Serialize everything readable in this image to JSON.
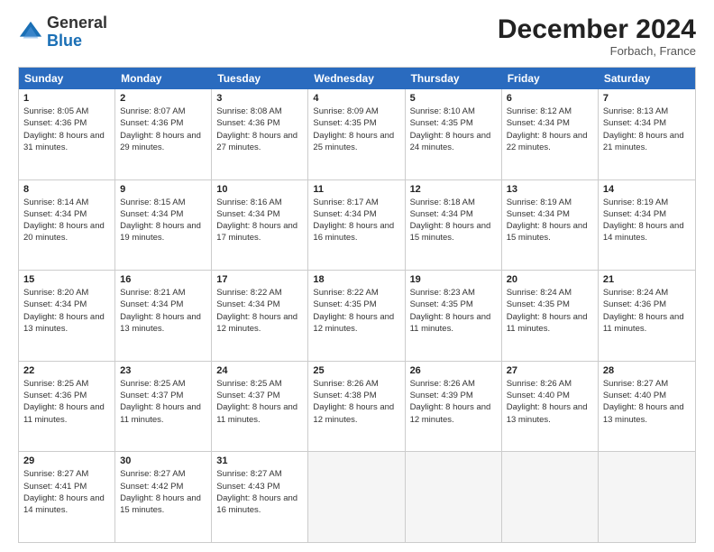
{
  "header": {
    "logo_line1": "General",
    "logo_line2": "Blue",
    "month": "December 2024",
    "location": "Forbach, France"
  },
  "weekdays": [
    "Sunday",
    "Monday",
    "Tuesday",
    "Wednesday",
    "Thursday",
    "Friday",
    "Saturday"
  ],
  "rows": [
    [
      {
        "day": "1",
        "sunrise": "8:05 AM",
        "sunset": "4:36 PM",
        "daylight": "8 hours and 31 minutes."
      },
      {
        "day": "2",
        "sunrise": "8:07 AM",
        "sunset": "4:36 PM",
        "daylight": "8 hours and 29 minutes."
      },
      {
        "day": "3",
        "sunrise": "8:08 AM",
        "sunset": "4:36 PM",
        "daylight": "8 hours and 27 minutes."
      },
      {
        "day": "4",
        "sunrise": "8:09 AM",
        "sunset": "4:35 PM",
        "daylight": "8 hours and 25 minutes."
      },
      {
        "day": "5",
        "sunrise": "8:10 AM",
        "sunset": "4:35 PM",
        "daylight": "8 hours and 24 minutes."
      },
      {
        "day": "6",
        "sunrise": "8:12 AM",
        "sunset": "4:34 PM",
        "daylight": "8 hours and 22 minutes."
      },
      {
        "day": "7",
        "sunrise": "8:13 AM",
        "sunset": "4:34 PM",
        "daylight": "8 hours and 21 minutes."
      }
    ],
    [
      {
        "day": "8",
        "sunrise": "8:14 AM",
        "sunset": "4:34 PM",
        "daylight": "8 hours and 20 minutes."
      },
      {
        "day": "9",
        "sunrise": "8:15 AM",
        "sunset": "4:34 PM",
        "daylight": "8 hours and 19 minutes."
      },
      {
        "day": "10",
        "sunrise": "8:16 AM",
        "sunset": "4:34 PM",
        "daylight": "8 hours and 17 minutes."
      },
      {
        "day": "11",
        "sunrise": "8:17 AM",
        "sunset": "4:34 PM",
        "daylight": "8 hours and 16 minutes."
      },
      {
        "day": "12",
        "sunrise": "8:18 AM",
        "sunset": "4:34 PM",
        "daylight": "8 hours and 15 minutes."
      },
      {
        "day": "13",
        "sunrise": "8:19 AM",
        "sunset": "4:34 PM",
        "daylight": "8 hours and 15 minutes."
      },
      {
        "day": "14",
        "sunrise": "8:19 AM",
        "sunset": "4:34 PM",
        "daylight": "8 hours and 14 minutes."
      }
    ],
    [
      {
        "day": "15",
        "sunrise": "8:20 AM",
        "sunset": "4:34 PM",
        "daylight": "8 hours and 13 minutes."
      },
      {
        "day": "16",
        "sunrise": "8:21 AM",
        "sunset": "4:34 PM",
        "daylight": "8 hours and 13 minutes."
      },
      {
        "day": "17",
        "sunrise": "8:22 AM",
        "sunset": "4:34 PM",
        "daylight": "8 hours and 12 minutes."
      },
      {
        "day": "18",
        "sunrise": "8:22 AM",
        "sunset": "4:35 PM",
        "daylight": "8 hours and 12 minutes."
      },
      {
        "day": "19",
        "sunrise": "8:23 AM",
        "sunset": "4:35 PM",
        "daylight": "8 hours and 11 minutes."
      },
      {
        "day": "20",
        "sunrise": "8:24 AM",
        "sunset": "4:35 PM",
        "daylight": "8 hours and 11 minutes."
      },
      {
        "day": "21",
        "sunrise": "8:24 AM",
        "sunset": "4:36 PM",
        "daylight": "8 hours and 11 minutes."
      }
    ],
    [
      {
        "day": "22",
        "sunrise": "8:25 AM",
        "sunset": "4:36 PM",
        "daylight": "8 hours and 11 minutes."
      },
      {
        "day": "23",
        "sunrise": "8:25 AM",
        "sunset": "4:37 PM",
        "daylight": "8 hours and 11 minutes."
      },
      {
        "day": "24",
        "sunrise": "8:25 AM",
        "sunset": "4:37 PM",
        "daylight": "8 hours and 11 minutes."
      },
      {
        "day": "25",
        "sunrise": "8:26 AM",
        "sunset": "4:38 PM",
        "daylight": "8 hours and 12 minutes."
      },
      {
        "day": "26",
        "sunrise": "8:26 AM",
        "sunset": "4:39 PM",
        "daylight": "8 hours and 12 minutes."
      },
      {
        "day": "27",
        "sunrise": "8:26 AM",
        "sunset": "4:40 PM",
        "daylight": "8 hours and 13 minutes."
      },
      {
        "day": "28",
        "sunrise": "8:27 AM",
        "sunset": "4:40 PM",
        "daylight": "8 hours and 13 minutes."
      }
    ],
    [
      {
        "day": "29",
        "sunrise": "8:27 AM",
        "sunset": "4:41 PM",
        "daylight": "8 hours and 14 minutes."
      },
      {
        "day": "30",
        "sunrise": "8:27 AM",
        "sunset": "4:42 PM",
        "daylight": "8 hours and 15 minutes."
      },
      {
        "day": "31",
        "sunrise": "8:27 AM",
        "sunset": "4:43 PM",
        "daylight": "8 hours and 16 minutes."
      },
      null,
      null,
      null,
      null
    ]
  ]
}
